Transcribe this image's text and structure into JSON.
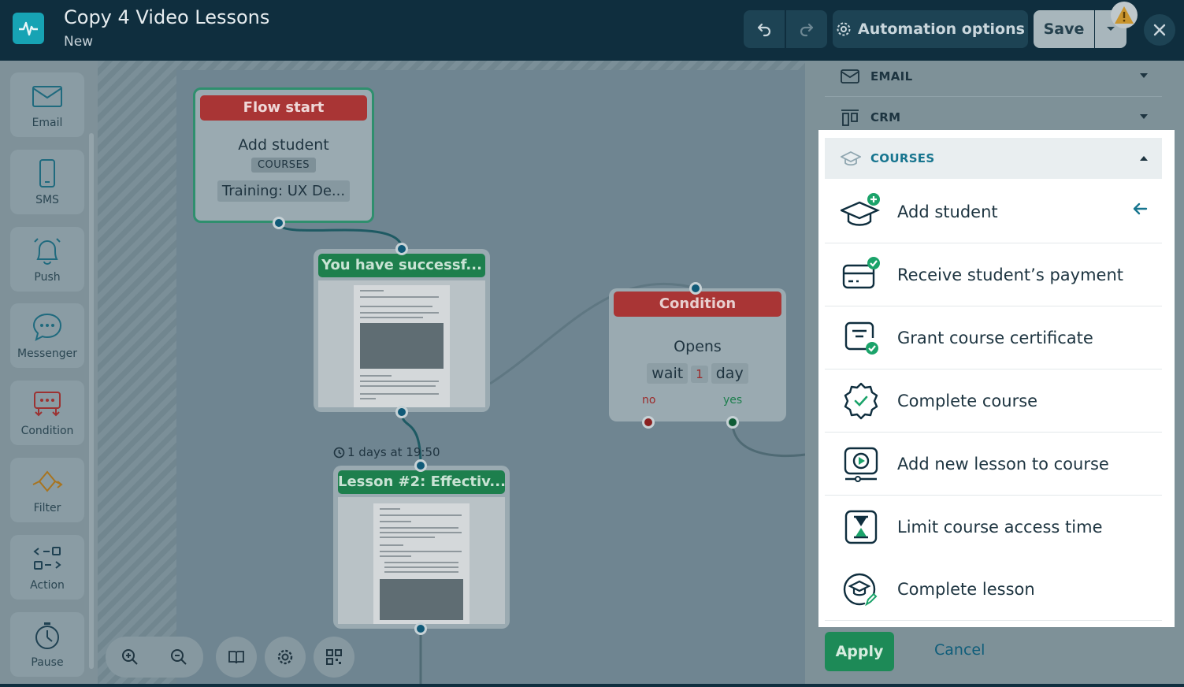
{
  "header": {
    "title": "Copy 4 Video Lessons",
    "subtitle": "New",
    "automation_options": "Automation options",
    "save": "Save"
  },
  "palette": [
    {
      "label": "Email",
      "icon": "envelope-icon"
    },
    {
      "label": "SMS",
      "icon": "phone-icon"
    },
    {
      "label": "Push",
      "icon": "bell-icon"
    },
    {
      "label": "Messenger",
      "icon": "chat-bubble-icon"
    },
    {
      "label": "Condition",
      "icon": "condition-icon"
    },
    {
      "label": "Filter",
      "icon": "filter-icon"
    },
    {
      "label": "Action",
      "icon": "action-icon"
    },
    {
      "label": "Pause",
      "icon": "stopwatch-icon"
    }
  ],
  "flow": {
    "start": {
      "head": "Flow start",
      "event": "Add student",
      "tag": "COURSES",
      "course": "Training: UX De..."
    },
    "email1": {
      "head": "You have successf..."
    },
    "condition": {
      "head": "Condition",
      "rule": "Opens",
      "wait_label": "wait",
      "wait_value": "1",
      "wait_unit": "day",
      "no": "no",
      "yes": "yes"
    },
    "delay": "1 days at 19:50",
    "email2": {
      "head": "Lesson #2: Effectiv..."
    }
  },
  "panel": {
    "sections": [
      {
        "label": "EMAIL",
        "icon": "envelope-icon",
        "expanded": false
      },
      {
        "label": "CRM",
        "icon": "crm-icon",
        "expanded": false
      },
      {
        "label": "COURSES",
        "icon": "graduation-cap-icon",
        "expanded": true
      }
    ],
    "course_items": [
      {
        "label": "Add student",
        "icon": "add-student-icon",
        "selected": true
      },
      {
        "label": "Receive student’s payment",
        "icon": "payment-icon"
      },
      {
        "label": "Grant course certificate",
        "icon": "certificate-icon"
      },
      {
        "label": "Complete course",
        "icon": "badge-check-icon"
      },
      {
        "label": "Add new lesson to course",
        "icon": "video-lesson-icon"
      },
      {
        "label": "Limit course access time",
        "icon": "hourglass-icon"
      },
      {
        "label": "Complete lesson",
        "icon": "lesson-complete-icon"
      }
    ],
    "apply": "Apply",
    "cancel": "Cancel"
  },
  "colors": {
    "header_bg": "#0f2e3e",
    "accent_teal": "#17758f",
    "success_green": "#1d8a57",
    "danger_red": "#a93535"
  }
}
